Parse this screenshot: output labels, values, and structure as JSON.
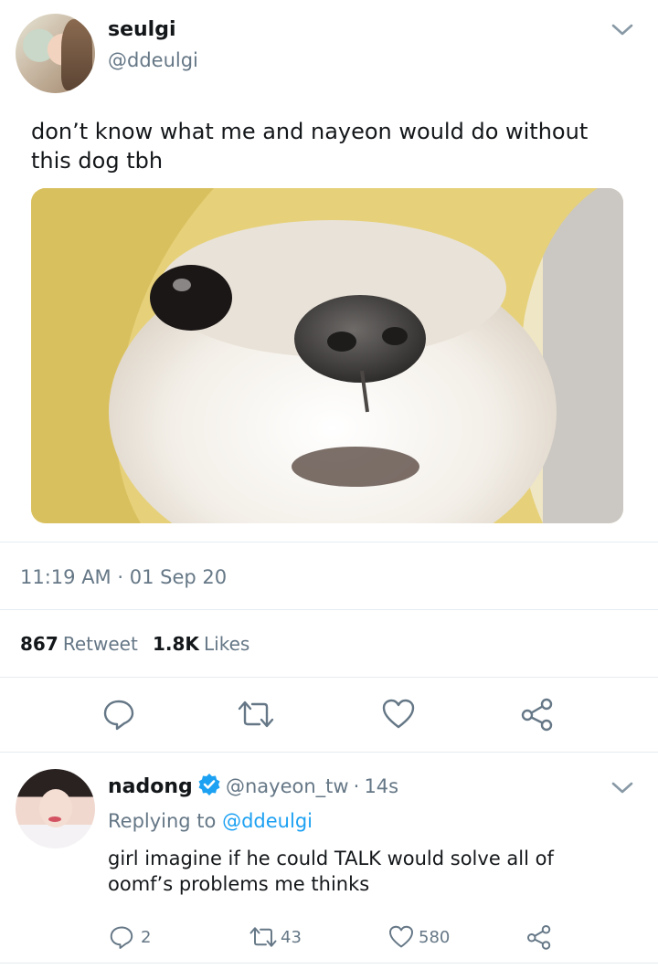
{
  "tweet": {
    "author_name": "seulgi",
    "author_handle": "@ddeulgi",
    "text": "don’t know what me and nayeon would do without this dog tbh",
    "time": "11:19 AM",
    "date": "01 Sep 20",
    "retweet_count": "867",
    "retweet_label": "Retweet",
    "like_count": "1.8K",
    "like_label": "Likes"
  },
  "reply": {
    "author_name": "nadong",
    "author_handle": "@nayeon_tw",
    "time_ago": "14s",
    "replying_to_label": "Replying to",
    "replying_to_handle": "@ddeulgi",
    "text": "girl imagine if he could TALK would solve all of oomf’s problems me thinks",
    "reply_count": "2",
    "retweet_count": "43",
    "like_count": "580"
  },
  "colors": {
    "accent": "#1da1f2",
    "icon_gray": "#657786",
    "divider": "#e6ecf0"
  },
  "icons": {
    "reply": "speech-bubble-icon",
    "retweet": "retweet-arrows-icon",
    "like": "heart-icon",
    "share": "share-icon",
    "more": "chevron-down-icon",
    "verified": "verified-badge-icon"
  }
}
